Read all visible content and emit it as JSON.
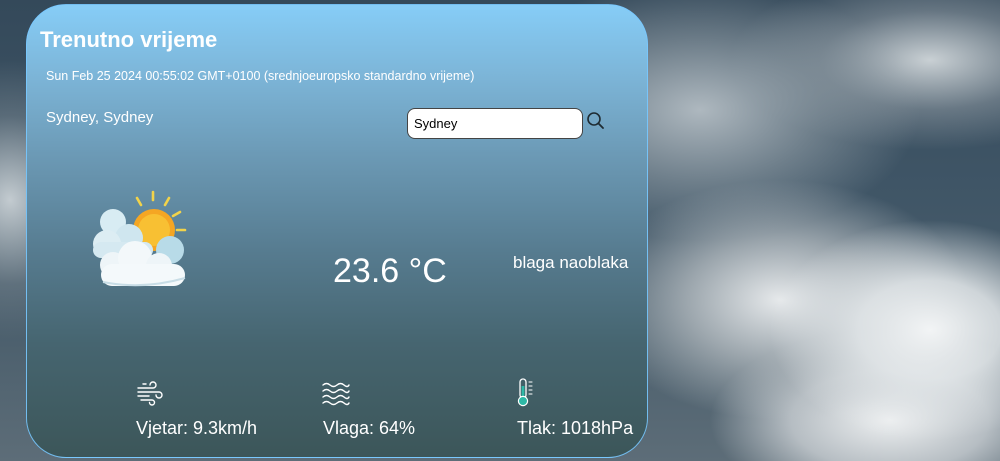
{
  "app": {
    "title": "Trenutno vrijeme",
    "datetime": "Sun Feb 25 2024 00:55:02 GMT+0100 (srednjoeuropsko standardno vrijeme)"
  },
  "location": {
    "name": "Sydney, Sydney"
  },
  "search": {
    "value": "Sydney",
    "icon": "search-icon"
  },
  "current": {
    "icon": "partly-cloudy-icon",
    "temperature": "23.6 °C",
    "description": "blaga naoblaka"
  },
  "stats": [
    {
      "icon": "wind-icon",
      "label": "Vjetar: 9.3km/h"
    },
    {
      "icon": "humidity-icon",
      "label": "Vlaga: 64%"
    },
    {
      "icon": "thermometer-icon",
      "label": "Tlak: 1018hPa"
    }
  ],
  "colors": {
    "card_top": "#86cdf7",
    "card_bottom": "#3c5659",
    "card_border": "#78c8ff",
    "sun": "#f7b52c",
    "cloud": "#e9f2f6"
  }
}
